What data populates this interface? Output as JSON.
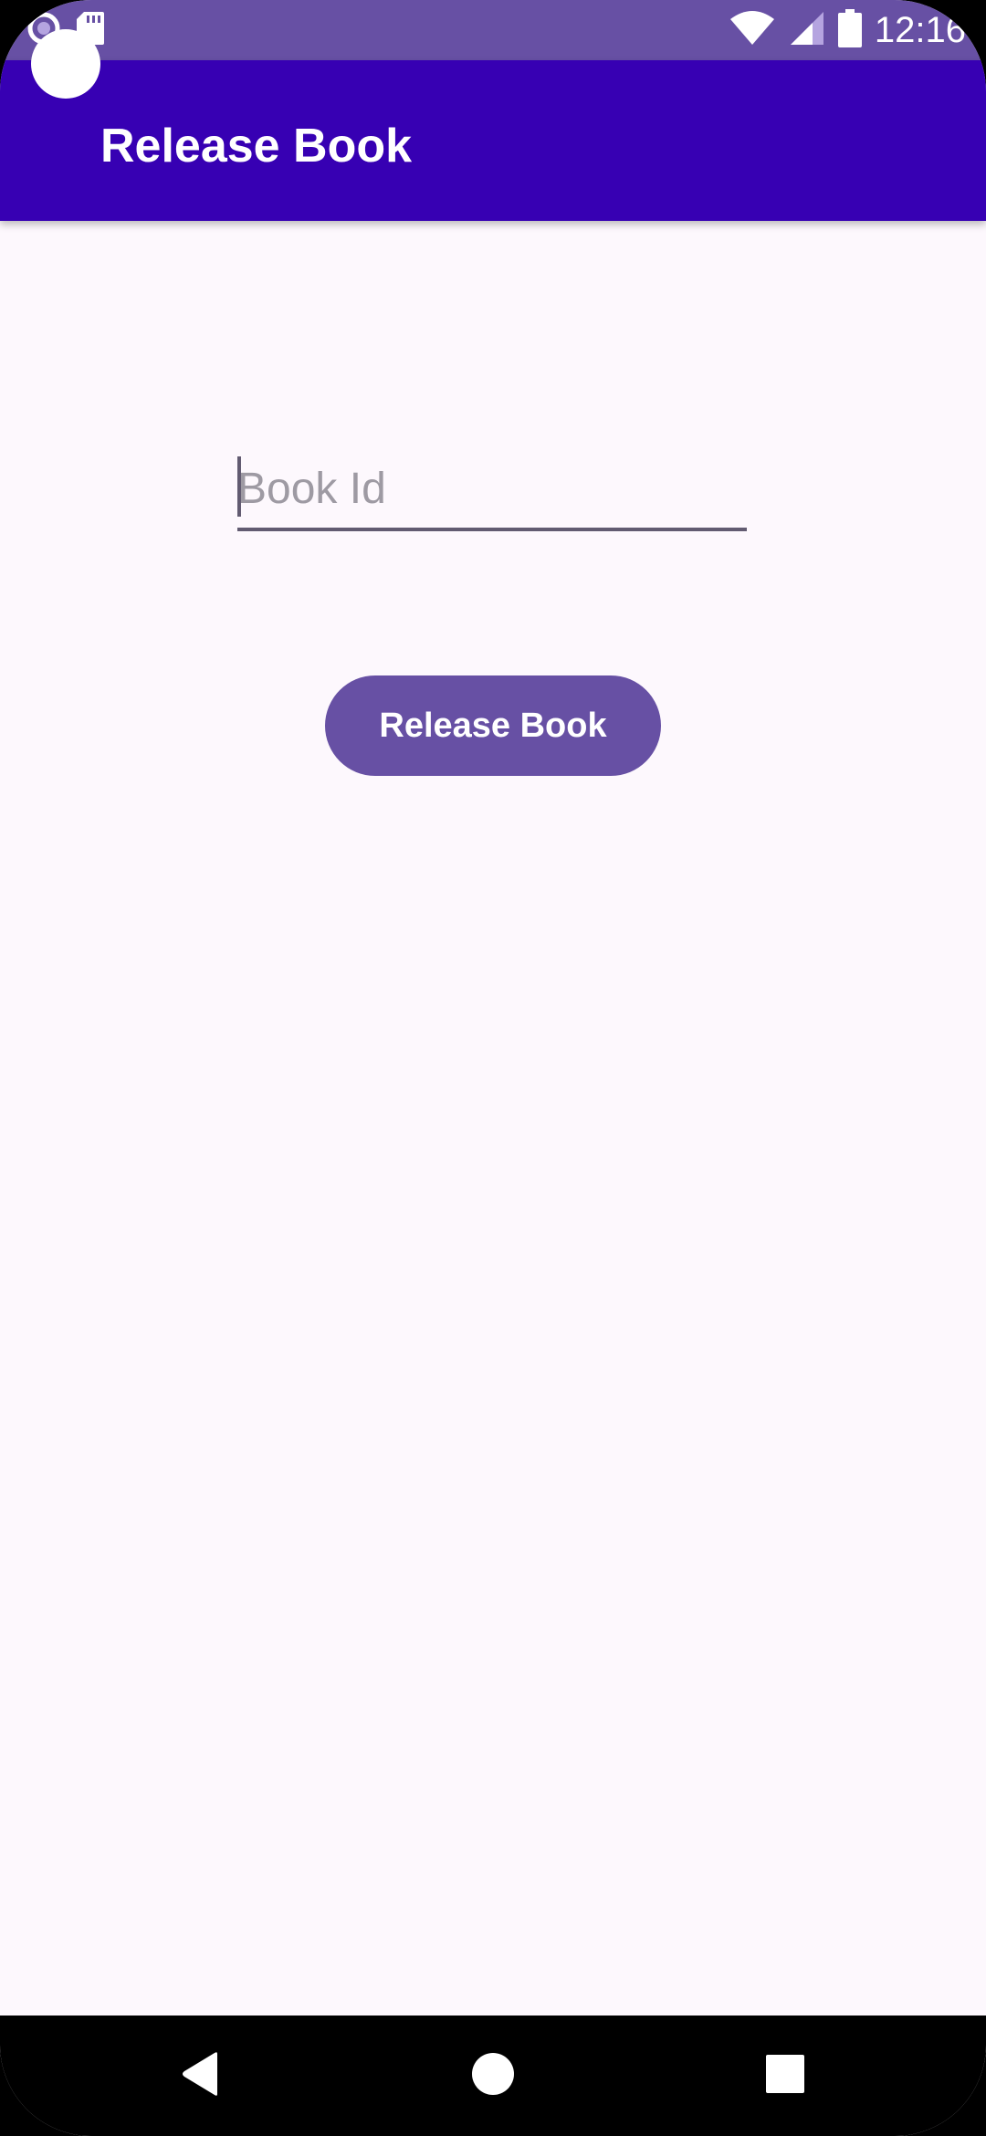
{
  "status_bar": {
    "time": "12:16",
    "icons": [
      "notification-icon",
      "sd-card-icon",
      "wifi-icon",
      "signal-icon",
      "battery-icon"
    ]
  },
  "app_bar": {
    "title": "Release Book"
  },
  "form": {
    "book_id": {
      "value": "",
      "placeholder": "Book Id"
    },
    "release_button_label": "Release Book"
  },
  "nav_bar": {
    "buttons": [
      "back-icon",
      "home-icon",
      "recents-icon"
    ]
  },
  "colors": {
    "status_bar": "#6750a4",
    "app_bar": "#3700b3",
    "button": "#6750a4",
    "background": "#fdf8fd"
  }
}
